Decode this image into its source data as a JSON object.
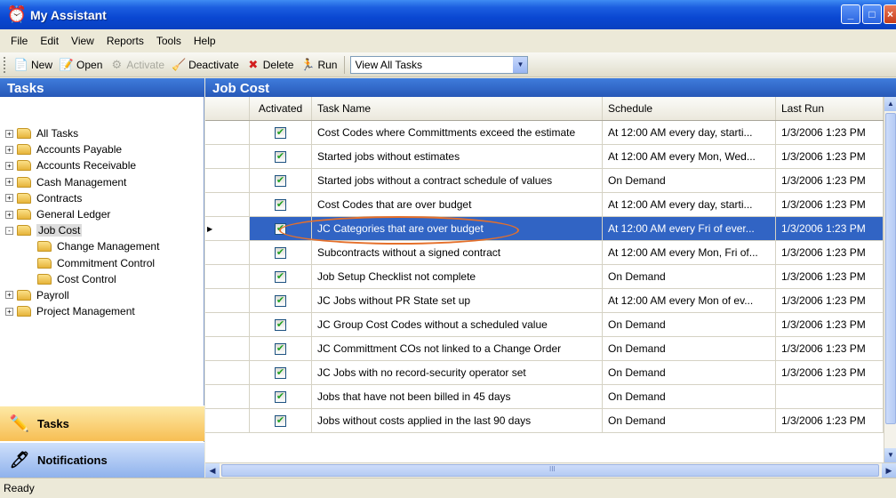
{
  "window": {
    "title": "My Assistant",
    "controls": [
      "minimize",
      "maximize",
      "close"
    ]
  },
  "menu": [
    "File",
    "Edit",
    "View",
    "Reports",
    "Tools",
    "Help"
  ],
  "toolbar": {
    "new_label": "New",
    "open_label": "Open",
    "activate_label": "Activate",
    "deactivate_label": "Deactivate",
    "delete_label": "Delete",
    "run_label": "Run",
    "view_filter": "View All Tasks"
  },
  "left_panel": {
    "title": "Tasks",
    "tree": [
      {
        "label": "All Tasks",
        "level": 0,
        "expander": "+"
      },
      {
        "label": "Accounts Payable",
        "level": 0,
        "expander": "+"
      },
      {
        "label": "Accounts Receivable",
        "level": 0,
        "expander": "+"
      },
      {
        "label": "Cash Management",
        "level": 0,
        "expander": "+"
      },
      {
        "label": "Contracts",
        "level": 0,
        "expander": "+"
      },
      {
        "label": "General Ledger",
        "level": 0,
        "expander": "+"
      },
      {
        "label": "Job Cost",
        "level": 0,
        "expander": "-",
        "selected": true
      },
      {
        "label": "Change Management",
        "level": 1
      },
      {
        "label": "Commitment Control",
        "level": 1
      },
      {
        "label": "Cost Control",
        "level": 1
      },
      {
        "label": "Payroll",
        "level": 0,
        "expander": "+"
      },
      {
        "label": "Project Management",
        "level": 0,
        "expander": "+"
      }
    ],
    "nav_tasks": "Tasks",
    "nav_notifications": "Notifications"
  },
  "grid": {
    "title": "Job Cost",
    "columns": [
      "Activated",
      "Task Name",
      "Schedule",
      "Last Run"
    ],
    "rows": [
      {
        "activated": true,
        "task": "Cost Codes where Committments exceed the estimate",
        "schedule": "At 12:00 AM every day, starti...",
        "last_run": "1/3/2006 1:23 PM"
      },
      {
        "activated": true,
        "task": "Started jobs without estimates",
        "schedule": "At 12:00 AM every Mon, Wed...",
        "last_run": "1/3/2006 1:23 PM"
      },
      {
        "activated": true,
        "task": "Started jobs without a contract schedule of values",
        "schedule": "On Demand",
        "last_run": "1/3/2006 1:23 PM"
      },
      {
        "activated": true,
        "task": "Cost Codes that are over budget",
        "schedule": "At 12:00 AM every day, starti...",
        "last_run": "1/3/2006 1:23 PM"
      },
      {
        "activated": true,
        "task": "JC Categories that are over budget",
        "schedule": "At 12:00 AM every Fri of ever...",
        "last_run": "1/3/2006 1:23 PM",
        "selected": true
      },
      {
        "activated": true,
        "task": "Subcontracts without a signed contract",
        "schedule": "At 12:00 AM every Mon, Fri of...",
        "last_run": "1/3/2006 1:23 PM"
      },
      {
        "activated": true,
        "task": "Job Setup Checklist not complete",
        "schedule": "On Demand",
        "last_run": "1/3/2006 1:23 PM"
      },
      {
        "activated": true,
        "task": "JC Jobs without PR State set up",
        "schedule": "At 12:00 AM every Mon of ev...",
        "last_run": "1/3/2006 1:23 PM"
      },
      {
        "activated": true,
        "task": "JC Group Cost Codes without a scheduled value",
        "schedule": "On Demand",
        "last_run": "1/3/2006 1:23 PM"
      },
      {
        "activated": true,
        "task": "JC Committment COs not linked to a Change Order",
        "schedule": "On Demand",
        "last_run": "1/3/2006 1:23 PM"
      },
      {
        "activated": true,
        "task": "JC Jobs with no record-security operator set",
        "schedule": "On Demand",
        "last_run": "1/3/2006 1:23 PM"
      },
      {
        "activated": true,
        "task": "Jobs that have not been billed in 45 days",
        "schedule": "On Demand",
        "last_run": ""
      },
      {
        "activated": true,
        "task": "Jobs without costs applied in the last 90 days",
        "schedule": "On Demand",
        "last_run": "1/3/2006 1:23 PM"
      }
    ],
    "scroll_thumb_label": "III"
  },
  "status": "Ready",
  "colors": {
    "title_blue": "#0a47d2",
    "selection_blue": "#3164c4",
    "highlight_orange": "#e5702b",
    "tasks_nav": "#f7be53"
  }
}
